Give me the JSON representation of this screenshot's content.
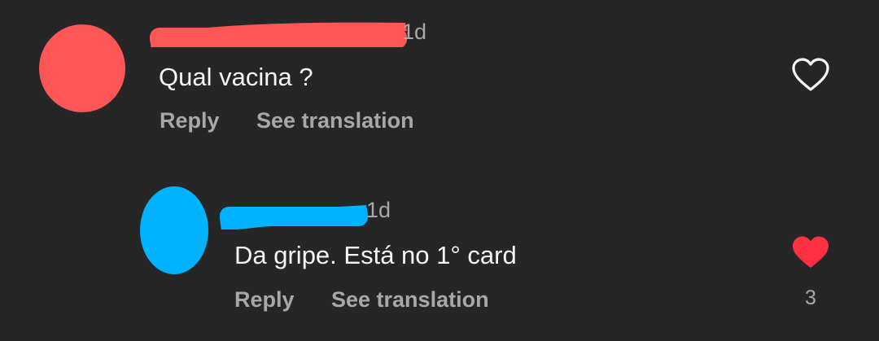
{
  "comments": [
    {
      "time": "1d",
      "text": "Qual vacina ?",
      "reply_label": "Reply",
      "translate_label": "See translation",
      "liked": false,
      "like_count": "",
      "avatar_color": "#ff5757",
      "redact_color": "#ff5757"
    },
    {
      "time": "1d",
      "text": "Da gripe. Está no 1° card",
      "reply_label": "Reply",
      "translate_label": "See translation",
      "liked": true,
      "like_count": "3",
      "avatar_color": "#00b2ff",
      "redact_color": "#00b2ff"
    }
  ],
  "colors": {
    "background": "#262626",
    "like_active": "#ff3040",
    "muted_text": "#a8a8a8"
  }
}
